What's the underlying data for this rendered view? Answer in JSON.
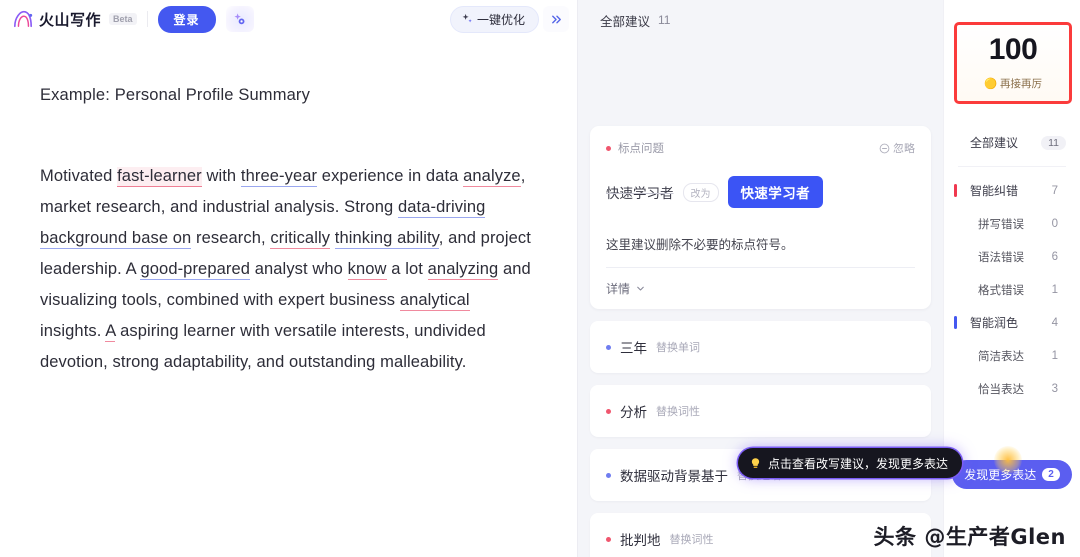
{
  "header": {
    "brand_name": "火山写作",
    "beta_label": "Beta",
    "login_label": "登录",
    "wand_icon": "magic-wand-icon",
    "optimize_label": "一键优化",
    "optimize_icon": "sparkle-icon",
    "collapse_icon": "double-chevron-right-icon"
  },
  "document": {
    "title": "Example: Personal Profile Summary",
    "paragraph": "Motivated fast-learner with three-year experience in data analyze, market research, and industrial analysis. Strong data-driving background base on research, critically thinking ability, and project leadership. A good-prepared analyst who know a lot analyzing and visualizing tools, combined with expert business analytical insights. A aspiring learner with versatile interests, undivided devotion, strong adaptability, and outstanding malleability.",
    "segments": [
      {
        "text": "Motivated ",
        "mark": "none"
      },
      {
        "text": "fast-learner",
        "mark": "red-highlight"
      },
      {
        "text": " with ",
        "mark": "none"
      },
      {
        "text": "three-year",
        "mark": "blue"
      },
      {
        "text": " experience in data ",
        "mark": "none"
      },
      {
        "text": "analyze",
        "mark": "red"
      },
      {
        "text": ", market research, and industrial analysis. Strong ",
        "mark": "none"
      },
      {
        "text": "data-driving background base on",
        "mark": "blue"
      },
      {
        "text": " research, ",
        "mark": "none"
      },
      {
        "text": "critically",
        "mark": "red"
      },
      {
        "text": " ",
        "mark": "none"
      },
      {
        "text": "thinking ability",
        "mark": "blue"
      },
      {
        "text": ", and project leadership. A ",
        "mark": "none"
      },
      {
        "text": "good-prepared",
        "mark": "blue"
      },
      {
        "text": " analyst who ",
        "mark": "none"
      },
      {
        "text": "know",
        "mark": "red"
      },
      {
        "text": " a lot ",
        "mark": "none"
      },
      {
        "text": "analyzing",
        "mark": "red"
      },
      {
        "text": " and visualizing tools, combined with expert business ",
        "mark": "none"
      },
      {
        "text": "analytical",
        "mark": "red"
      },
      {
        "text": " insights. ",
        "mark": "none"
      },
      {
        "text": "A",
        "mark": "red"
      },
      {
        "text": " aspiring learner with versatile interests, undivided devotion, strong adaptability, and outstanding malleability.",
        "mark": "none"
      }
    ]
  },
  "suggestions": {
    "header_label": "全部建议",
    "header_count": "11",
    "card": {
      "tag": "标点问题",
      "ignore_label": "忽略",
      "ignore_icon": "circle-minus-icon",
      "original": "快速学习者",
      "arrow_label": "改为",
      "replacement": "快速学习者",
      "description": "这里建议删除不必要的标点符号。",
      "detail_label": "详情",
      "detail_icon": "chevron-down-icon"
    },
    "rows": [
      {
        "word": "三年",
        "action": "替换单词",
        "dot": "blue"
      },
      {
        "word": "分析",
        "action": "替换词性",
        "dot": "red"
      },
      {
        "word": "数据驱动背景基于",
        "action": "替换短语",
        "dot": "blue"
      },
      {
        "word": "批判地",
        "action": "替换词性",
        "dot": "red"
      }
    ]
  },
  "sidebar": {
    "score": "100",
    "score_emoji": "🟡",
    "score_sub": "再接再厉",
    "nav": [
      {
        "label": "全部建议",
        "count": "11",
        "style": "pill",
        "marker": "none",
        "sub": false
      },
      {
        "label": "智能纠错",
        "count": "7",
        "style": "num",
        "marker": "red",
        "sub": false
      },
      {
        "label": "拼写错误",
        "count": "0",
        "style": "num",
        "marker": "none",
        "sub": true
      },
      {
        "label": "语法错误",
        "count": "6",
        "style": "num",
        "marker": "none",
        "sub": true
      },
      {
        "label": "格式错误",
        "count": "1",
        "style": "num",
        "marker": "none",
        "sub": true
      },
      {
        "label": "智能润色",
        "count": "4",
        "style": "num",
        "marker": "blue",
        "sub": false
      },
      {
        "label": "简洁表达",
        "count": "1",
        "style": "num",
        "marker": "none",
        "sub": true
      },
      {
        "label": "恰当表达",
        "count": "3",
        "style": "num",
        "marker": "none",
        "sub": true
      }
    ],
    "discover_label": "发现更多表达",
    "discover_count": "2"
  },
  "tooltip": {
    "icon": "lightbulb-icon",
    "text": "点击查看改写建议，发现更多表达"
  },
  "watermark": "头条 @生产者Glen",
  "colors": {
    "brand_blue": "#4458f0",
    "error_red": "#f0384f",
    "polish_blue": "#4458f0",
    "score_border": "#fb3b3b",
    "tooltip_glow": "#7b5cf5"
  }
}
